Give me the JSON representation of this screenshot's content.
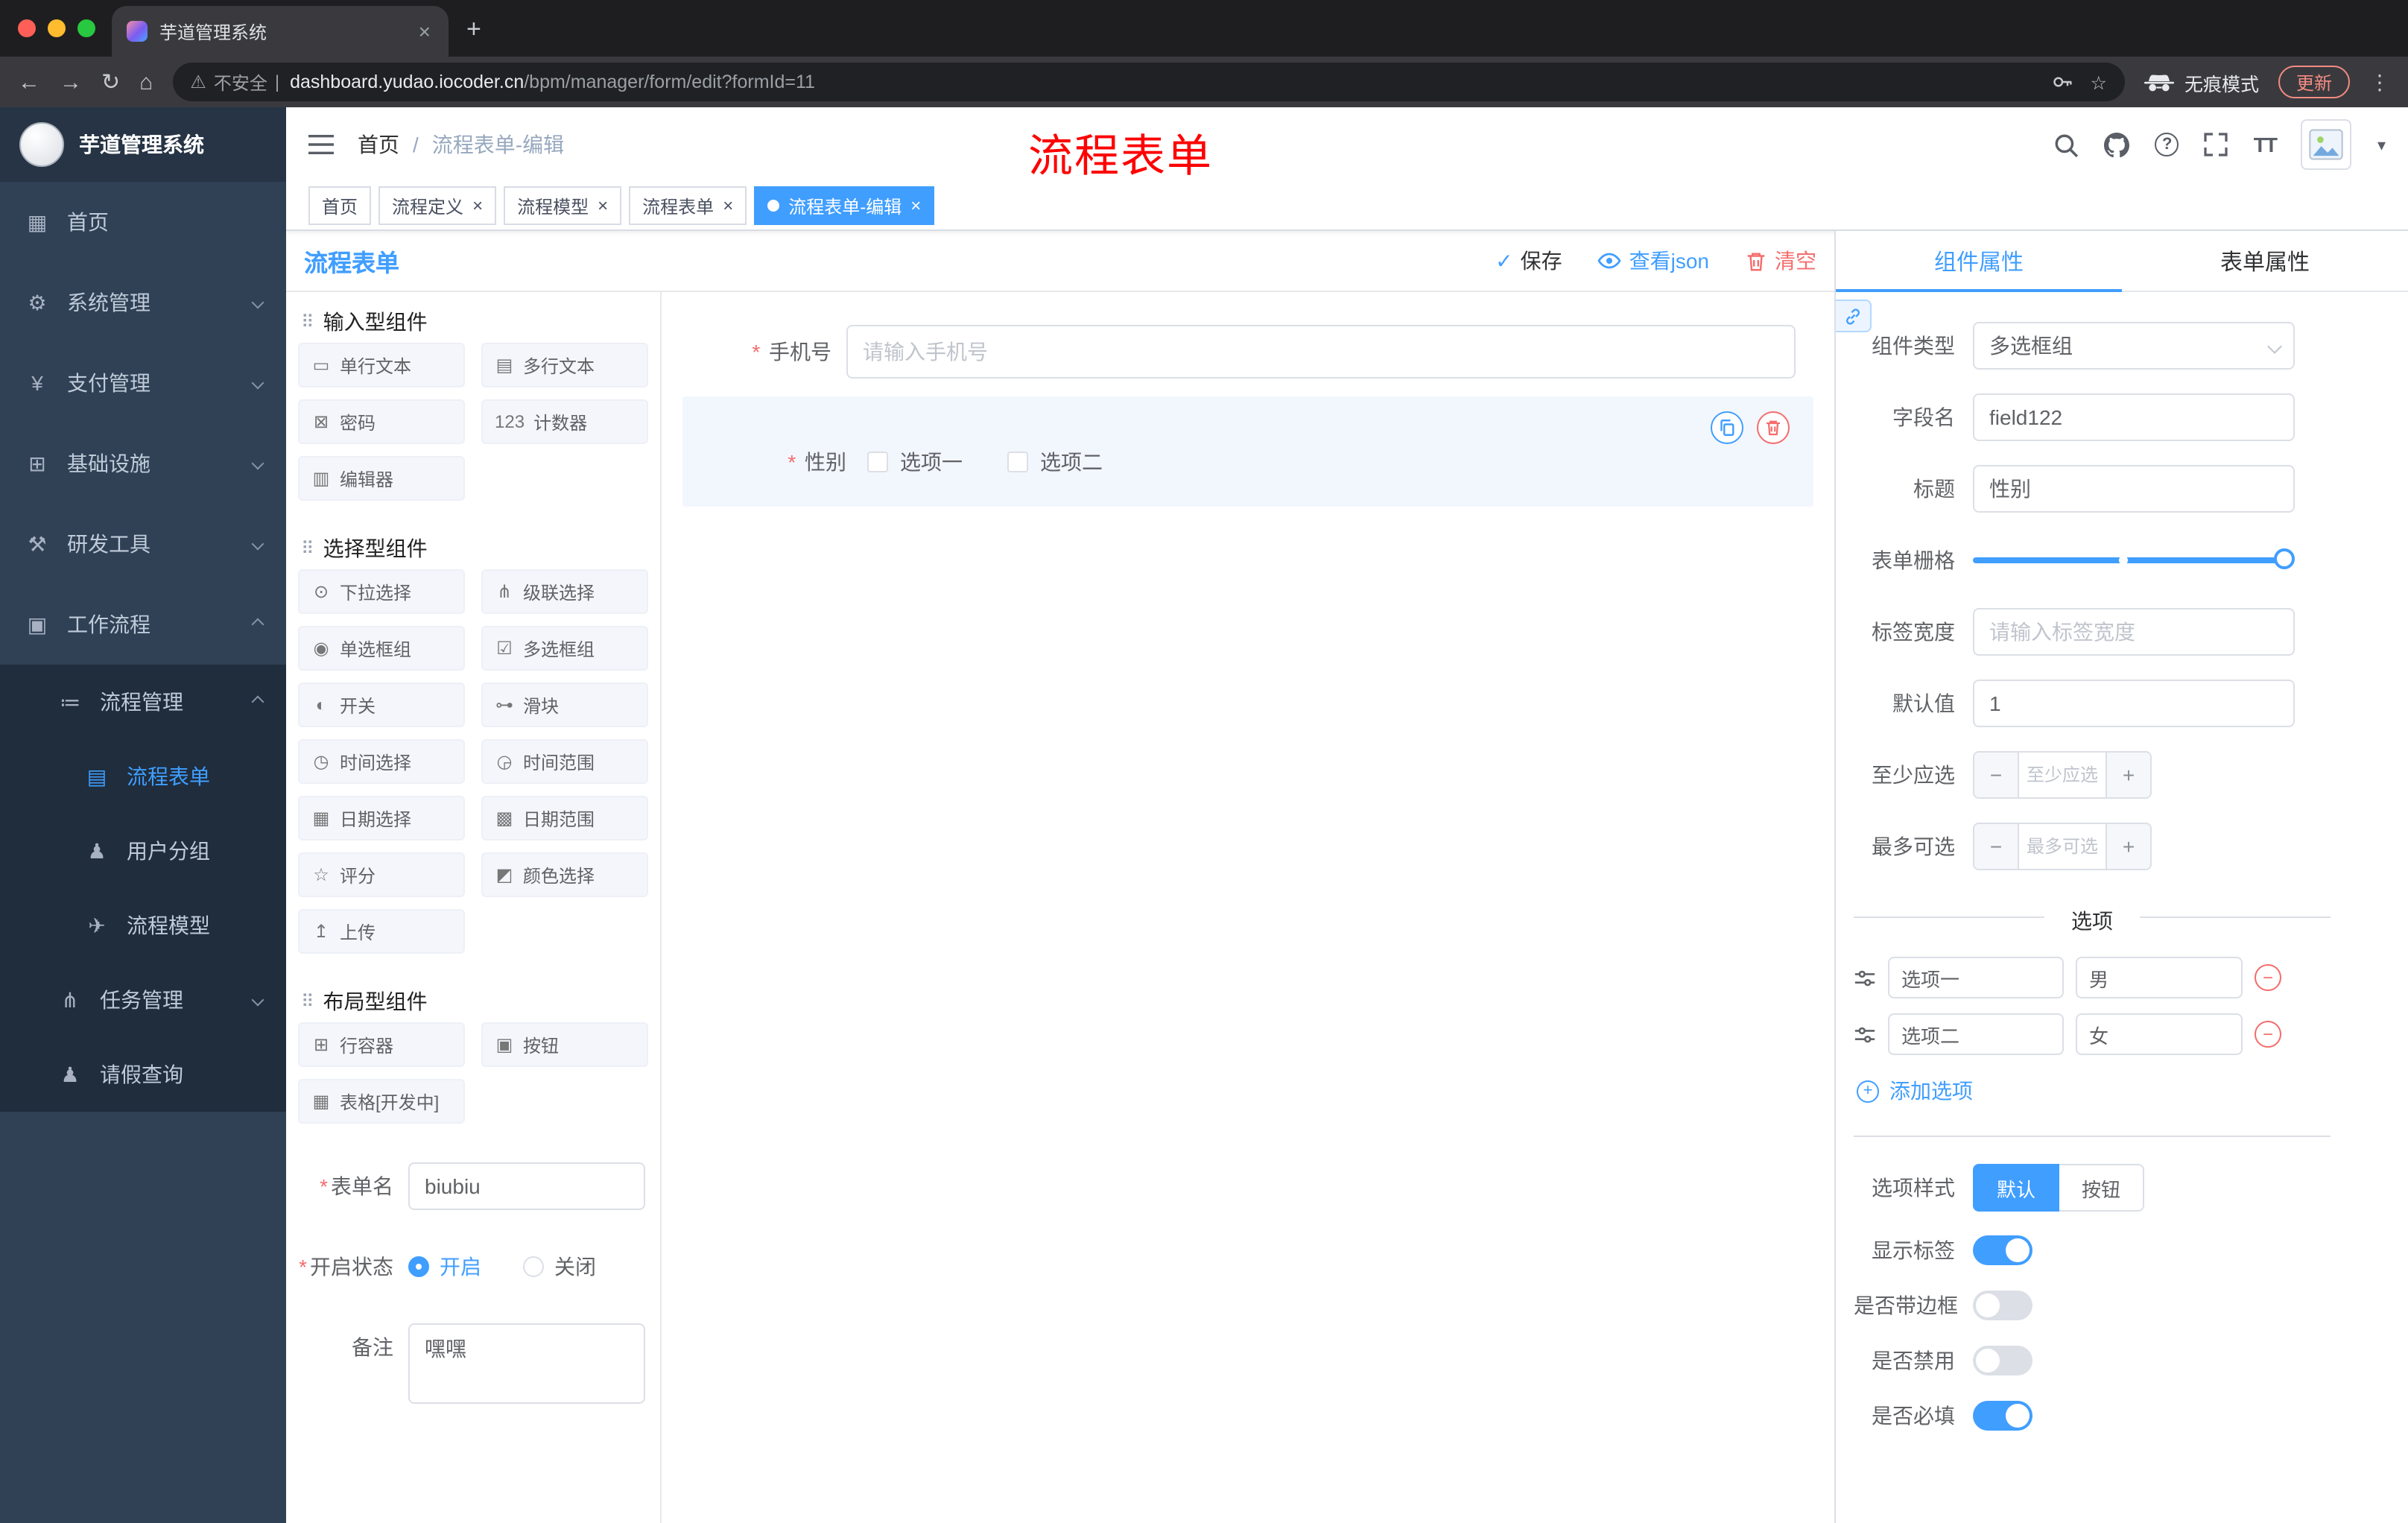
{
  "colors": {
    "accent": "#409EFF",
    "danger": "#F56C6C",
    "annotation_red": "#FE0000",
    "sidebar_bg": "#304156",
    "sidebar_sub_bg": "#1F2D3D",
    "active_tag_bg": "#409EFF"
  },
  "glyphs": {
    "asterisk": "*",
    "slash": "/",
    "check": "✓",
    "close": "×",
    "plus": "+",
    "minus": "−",
    "dots": "⋮",
    "caret": "▾",
    "back": "←",
    "forward": "→",
    "reload": "↻",
    "home": "⌂",
    "warning": "⚠",
    "star": "☆",
    "divider": "|",
    "question": "?",
    "textsize": "TT",
    "drag": "⠿",
    "dashboard": "▦",
    "gear": "⚙",
    "yen": "¥",
    "infra": "⊞",
    "tool": "⚒",
    "work": "▣",
    "list": "≔",
    "doc": "▤",
    "users": "♟",
    "send": "✈",
    "branch": "⋔",
    "person": "♟"
  },
  "browser": {
    "tab": {
      "title": "芋道管理系统"
    },
    "url": {
      "warning": "不安全",
      "host": "dashboard.yudao.iocoder.cn",
      "path": "/bpm/manager/form/edit?formId=11"
    },
    "incognito_label": "无痕模式",
    "update_label": "更新"
  },
  "sidebar": {
    "logo_title": "芋道管理系统",
    "items": [
      {
        "id": "home",
        "label": "首页",
        "icon": "dashboard",
        "level": 1,
        "arrow": ""
      },
      {
        "id": "system",
        "label": "系统管理",
        "icon": "gear",
        "level": 1,
        "arrow": "down"
      },
      {
        "id": "payment",
        "label": "支付管理",
        "icon": "yen",
        "level": 1,
        "arrow": "down"
      },
      {
        "id": "infra",
        "label": "基础设施",
        "icon": "infra",
        "level": 1,
        "arrow": "down"
      },
      {
        "id": "devtools",
        "label": "研发工具",
        "icon": "tool",
        "level": 1,
        "arrow": "down"
      },
      {
        "id": "workflow",
        "label": "工作流程",
        "icon": "work",
        "level": 1,
        "arrow": "up"
      },
      {
        "id": "process-mgmt",
        "label": "流程管理",
        "icon": "list",
        "level": 2,
        "arrow": "up"
      },
      {
        "id": "process-form",
        "label": "流程表单",
        "icon": "doc",
        "level": 3,
        "active": true
      },
      {
        "id": "user-group",
        "label": "用户分组",
        "icon": "users",
        "level": 3
      },
      {
        "id": "process-model",
        "label": "流程模型",
        "icon": "send",
        "level": 3
      },
      {
        "id": "task-mgmt",
        "label": "任务管理",
        "icon": "branch",
        "level": 2,
        "arrow": "down"
      },
      {
        "id": "leave-query",
        "label": "请假查询",
        "icon": "person",
        "level": 2
      }
    ]
  },
  "header": {
    "breadcrumb": [
      "首页",
      "流程表单-编辑"
    ],
    "annotation": "流程表单"
  },
  "tags": [
    {
      "id": "home",
      "label": "首页",
      "closable": false,
      "active": false
    },
    {
      "id": "process-def",
      "label": "流程定义",
      "closable": true,
      "active": false
    },
    {
      "id": "process-model",
      "label": "流程模型",
      "closable": true,
      "active": false
    },
    {
      "id": "process-form",
      "label": "流程表单",
      "closable": true,
      "active": false
    },
    {
      "id": "process-form-edit",
      "label": "流程表单-编辑",
      "closable": true,
      "active": true
    }
  ],
  "designer": {
    "title": "流程表单",
    "actions": {
      "save": "保存",
      "view_json": "查看json",
      "clear": "清空"
    },
    "palette": {
      "sections": [
        {
          "title": "输入型组件",
          "items": [
            {
              "id": "input-text",
              "label": "单行文本",
              "glyph": "▭"
            },
            {
              "id": "textarea",
              "label": "多行文本",
              "glyph": "▤"
            },
            {
              "id": "password",
              "label": "密码",
              "glyph": "⊠"
            },
            {
              "id": "counter",
              "label": "计数器",
              "glyph": "123"
            },
            {
              "id": "editor",
              "label": "编辑器",
              "glyph": "▥"
            }
          ]
        },
        {
          "title": "选择型组件",
          "items": [
            {
              "id": "select",
              "label": "下拉选择",
              "glyph": "⊙"
            },
            {
              "id": "cascader",
              "label": "级联选择",
              "glyph": "⋔"
            },
            {
              "id": "radio-group",
              "label": "单选框组",
              "glyph": "◉"
            },
            {
              "id": "checkbox-group",
              "label": "多选框组",
              "glyph": "☑"
            },
            {
              "id": "switch",
              "label": "开关",
              "glyph": "◐"
            },
            {
              "id": "slider",
              "label": "滑块",
              "glyph": "⊶"
            },
            {
              "id": "time-picker",
              "label": "时间选择",
              "glyph": "◷"
            },
            {
              "id": "time-range",
              "label": "时间范围",
              "glyph": "◶"
            },
            {
              "id": "date-picker",
              "label": "日期选择",
              "glyph": "▦"
            },
            {
              "id": "date-range",
              "label": "日期范围",
              "glyph": "▩"
            },
            {
              "id": "rate",
              "label": "评分",
              "glyph": "☆"
            },
            {
              "id": "color-picker",
              "label": "颜色选择",
              "glyph": "◩"
            },
            {
              "id": "upload",
              "label": "上传",
              "glyph": "↥"
            }
          ]
        },
        {
          "title": "布局型组件",
          "items": [
            {
              "id": "row",
              "label": "行容器",
              "glyph": "⊞"
            },
            {
              "id": "button",
              "label": "按钮",
              "glyph": "▣"
            },
            {
              "id": "table",
              "label": "表格[开发中]",
              "glyph": "▦"
            }
          ]
        }
      ]
    },
    "meta": {
      "name": {
        "label": "表单名",
        "required": true,
        "value": "biubiu"
      },
      "status": {
        "label": "开启状态",
        "required": true,
        "options": [
          {
            "label": "开启",
            "selected": true
          },
          {
            "label": "关闭",
            "selected": false
          }
        ]
      },
      "remark": {
        "label": "备注",
        "value": "嘿嘿"
      }
    },
    "canvas": {
      "phone": {
        "label": "手机号",
        "required": true,
        "placeholder": "请输入手机号",
        "value": ""
      },
      "gender": {
        "label": "性别",
        "required": true,
        "options": [
          "选项一",
          "选项二"
        ],
        "selected": true
      }
    }
  },
  "properties": {
    "tabs": [
      {
        "id": "component-props",
        "label": "组件属性",
        "active": true
      },
      {
        "id": "form-props",
        "label": "表单属性",
        "active": false
      }
    ],
    "rows": {
      "component_type": {
        "label": "组件类型",
        "value": "多选框组"
      },
      "field_name": {
        "label": "字段名",
        "value": "field122"
      },
      "title": {
        "label": "标题",
        "value": "性别"
      },
      "grid": {
        "label": "表单栅格",
        "value_percent": 100,
        "stop_percent": 47
      },
      "label_width": {
        "label": "标签宽度",
        "placeholder": "请输入标签宽度",
        "value": ""
      },
      "default": {
        "label": "默认值",
        "value": "1"
      },
      "min": {
        "label": "至少应选",
        "placeholder": "至少应选",
        "value": ""
      },
      "max": {
        "label": "最多可选",
        "placeholder": "最多可选",
        "value": ""
      }
    },
    "options_section": {
      "divider_title": "选项",
      "items": [
        {
          "label": "选项一",
          "value": "男"
        },
        {
          "label": "选项二",
          "value": "女"
        }
      ],
      "add_label": "添加选项"
    },
    "style": {
      "label": "选项样式",
      "choices": [
        {
          "id": "default",
          "label": "默认",
          "selected": true
        },
        {
          "id": "button",
          "label": "按钮",
          "selected": false
        }
      ]
    },
    "toggles": [
      {
        "id": "show-label",
        "label": "显示标签",
        "on": true
      },
      {
        "id": "with-border",
        "label": "是否带边框",
        "on": false
      },
      {
        "id": "disabled",
        "label": "是否禁用",
        "on": false
      },
      {
        "id": "required",
        "label": "是否必填",
        "on": true
      }
    ]
  }
}
